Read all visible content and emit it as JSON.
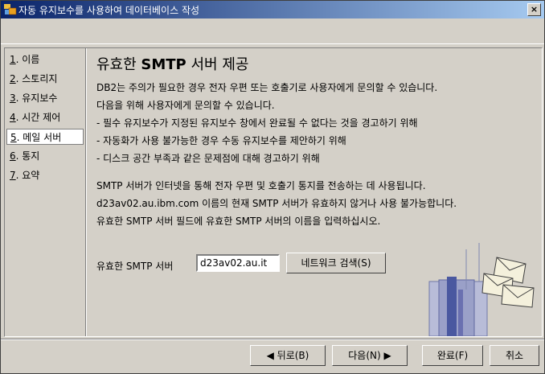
{
  "window": {
    "title": "자동 유지보수를 사용하여 데이터베이스 작성",
    "close_label": "×"
  },
  "nav": {
    "items": [
      {
        "num": "1",
        "label": ". 이름"
      },
      {
        "num": "2",
        "label": ". 스토리지"
      },
      {
        "num": "3",
        "label": ". 유지보수"
      },
      {
        "num": "4",
        "label": ". 시간 제어"
      },
      {
        "num": "5",
        "label": ". 메일 서버"
      },
      {
        "num": "6",
        "label": ". 통지"
      },
      {
        "num": "7",
        "label": ". 요약"
      }
    ]
  },
  "main": {
    "title_prefix": "유효한 ",
    "title_bold": "SMTP",
    "title_suffix": " 서버 제공",
    "paragraph1": [
      "DB2는 주의가 필요한 경우 전자 우편 또는 호출기로 사용자에게 문의할 수 있습니다.",
      "다음을 위해 사용자에게 문의할 수 있습니다.",
      "- 필수 유지보수가 지정된 유지보수 창에서 완료될 수 없다는 것을 경고하기 위해",
      "- 자동화가 사용 불가능한 경우 수동 유지보수를 제안하기 위해",
      "- 디스크 공간 부족과 같은 문제점에 대해 경고하기 위해"
    ],
    "paragraph2": [
      "SMTP 서버가 인터넷을 통해 전자 우편 및 호출기 통지를 전송하는 데 사용됩니다.",
      "d23av02.au.ibm.com 이름의 현재 SMTP 서버가 유효하지 않거나 사용 불가능합니다.",
      "유효한 SMTP 서버 필드에 유효한 SMTP 서버의 이름을 입력하십시오."
    ],
    "smtp_label": "유효한 SMTP 서버",
    "smtp_value": "d23av02.au.it",
    "network_search_label": "네트워크 검색(S)"
  },
  "footer": {
    "back_label": "◀ 뒤로(B)",
    "next_label": "다음(N) ▶",
    "finish_label": "완료(F)",
    "cancel_label": "취소"
  }
}
